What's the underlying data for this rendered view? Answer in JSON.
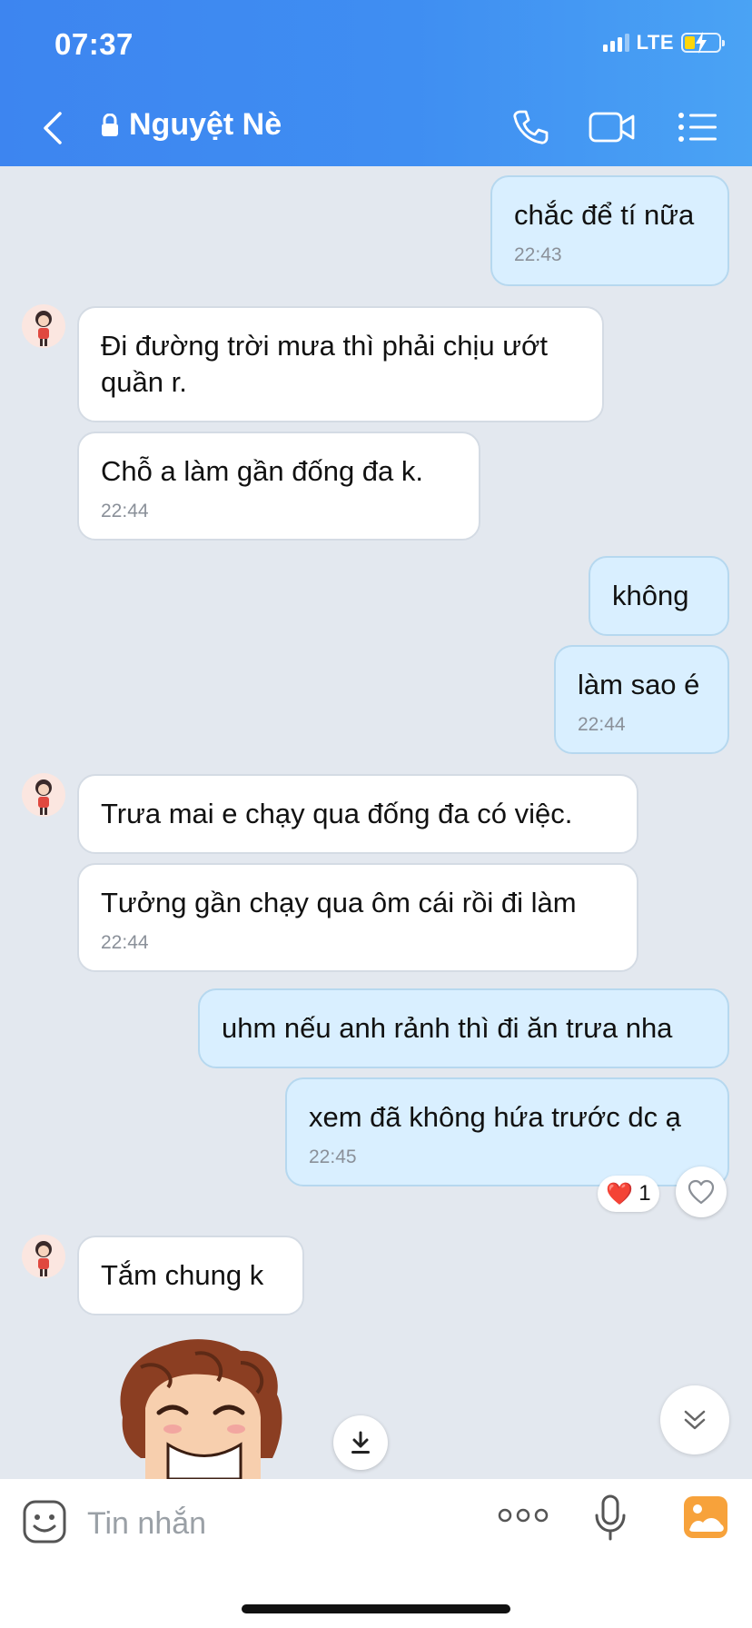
{
  "status": {
    "time": "07:37",
    "network": "LTE"
  },
  "header": {
    "title": "Nguyệt Nè"
  },
  "messages": [
    {
      "dir": "out",
      "text": "chắc để tí nữa",
      "time": "22:43"
    },
    {
      "dir": "in",
      "text": "Đi đường trời mưa thì phải chịu ướt quần r."
    },
    {
      "dir": "in",
      "text": "Chỗ a làm gần đống đa k.",
      "time": "22:44"
    },
    {
      "dir": "out",
      "text": "không"
    },
    {
      "dir": "out",
      "text": "làm sao é",
      "time": "22:44"
    },
    {
      "dir": "in",
      "text": "Trưa mai e chạy qua đống đa có việc."
    },
    {
      "dir": "in",
      "text": "Tưởng gần chạy qua ôm cái rồi đi làm",
      "time": "22:44"
    },
    {
      "dir": "out",
      "text": "uhm nếu anh rảnh thì đi ăn trưa nha"
    },
    {
      "dir": "out",
      "text": "xem đã không hứa trước dc ạ",
      "time": "22:45"
    },
    {
      "dir": "in",
      "text": "Tắm chung k"
    }
  ],
  "reaction": {
    "emoji": "❤️",
    "count": "1"
  },
  "input": {
    "placeholder": "Tin nhắn"
  },
  "colors": {
    "header_start": "#3d85f0",
    "header_end": "#4aa3f4",
    "outgoing_bubble": "#d9efff",
    "incoming_bubble": "#ffffff",
    "background": "#e3e8ef"
  }
}
